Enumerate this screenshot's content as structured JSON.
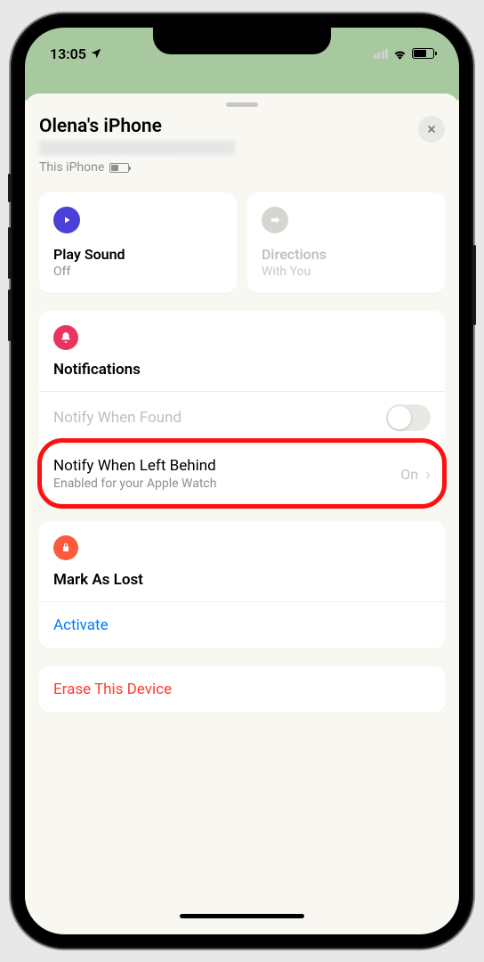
{
  "status": {
    "time": "13:05"
  },
  "header": {
    "title": "Olena's iPhone",
    "subtitle": "This iPhone"
  },
  "actions": {
    "play_sound": {
      "title": "Play Sound",
      "sub": "Off"
    },
    "directions": {
      "title": "Directions",
      "sub": "With You"
    }
  },
  "notifications": {
    "title": "Notifications",
    "notify_found": {
      "label": "Notify When Found"
    },
    "notify_left": {
      "label": "Notify When Left Behind",
      "sub": "Enabled for your Apple Watch",
      "value": "On"
    }
  },
  "lost": {
    "title": "Mark As Lost",
    "activate": "Activate"
  },
  "erase": {
    "label": "Erase This Device"
  }
}
